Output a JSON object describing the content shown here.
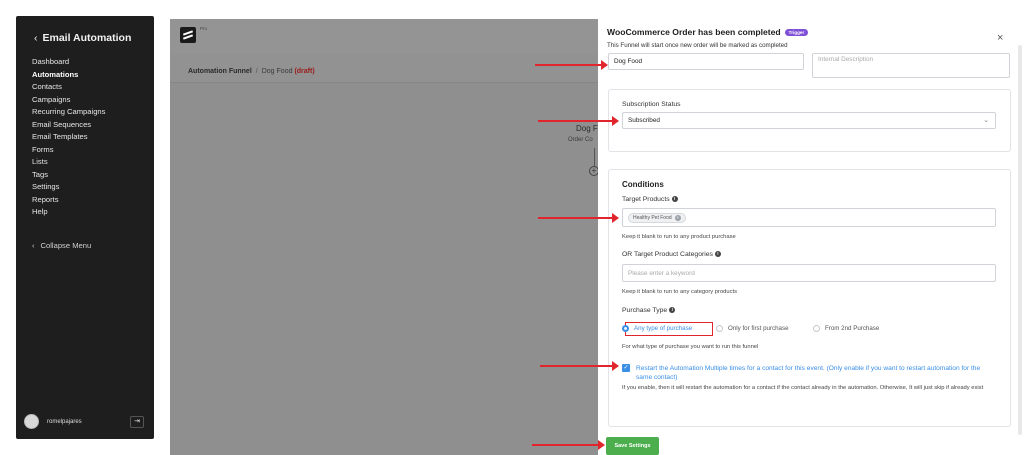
{
  "sidebar": {
    "title": "Email Automation",
    "items": [
      {
        "label": "Dashboard",
        "active": false
      },
      {
        "label": "Automations",
        "active": true
      },
      {
        "label": "Contacts",
        "active": false
      },
      {
        "label": "Campaigns",
        "active": false
      },
      {
        "label": "Recurring Campaigns",
        "active": false
      },
      {
        "label": "Email Sequences",
        "active": false
      },
      {
        "label": "Email Templates",
        "active": false
      },
      {
        "label": "Forms",
        "active": false
      },
      {
        "label": "Lists",
        "active": false
      },
      {
        "label": "Tags",
        "active": false
      },
      {
        "label": "Settings",
        "active": false
      },
      {
        "label": "Reports",
        "active": false
      },
      {
        "label": "Help",
        "active": false
      }
    ],
    "collapse_label": "Collapse Menu",
    "username": "romelpajares"
  },
  "main": {
    "pro_label": "Pro",
    "breadcrumb": {
      "root": "Automation Funnel",
      "separator": "/",
      "current": "Dog Food",
      "status": "(draft)"
    },
    "node": {
      "title": "Dog F",
      "subtitle": "Order Co"
    }
  },
  "panel": {
    "title": "WooCommerce Order has been completed",
    "badge": "Trigger",
    "subtitle": "This Funnel will start once new order will be marked as completed",
    "funnel_name_value": "Dog Food",
    "description_placeholder": "Internal Description",
    "subscription": {
      "label": "Subscription Status",
      "value": "Subscribed"
    },
    "conditions": {
      "heading": "Conditions",
      "target_products_label": "Target Products",
      "target_products_chips": [
        "Healthy Pet Food"
      ],
      "target_products_hint": "Keep it blank to run to any product purchase",
      "categories_label": "OR Target Product Categories",
      "categories_placeholder": "Please enter a keyword",
      "categories_hint": "Keep it blank to run to any category products",
      "purchase_type_label": "Purchase Type",
      "purchase_options": [
        {
          "label": "Any type of purchase",
          "selected": true
        },
        {
          "label": "Only for first purchase",
          "selected": false
        },
        {
          "label": "From 2nd Purchase",
          "selected": false
        }
      ],
      "purchase_hint": "For what type of purchase you want to run this funnel",
      "restart_label": "Restart the Automation Multiple times for a contact for this event. (Only enable if you want to restart automation for the same contact)",
      "restart_checked": true,
      "restart_hint": "If you enable, then it will restart the automation for a contact if the contact already in the automation. Otherwise, It will just skip if already exist"
    },
    "save_label": "Save Settings"
  },
  "colors": {
    "sidebar_bg": "#1e1e1e",
    "accent_blue": "#3a8ee6",
    "save_green": "#4cae4c",
    "badge_purple": "#7f4fd6",
    "annotation_red": "#e0262c",
    "draft_red": "#9b1b1b"
  }
}
